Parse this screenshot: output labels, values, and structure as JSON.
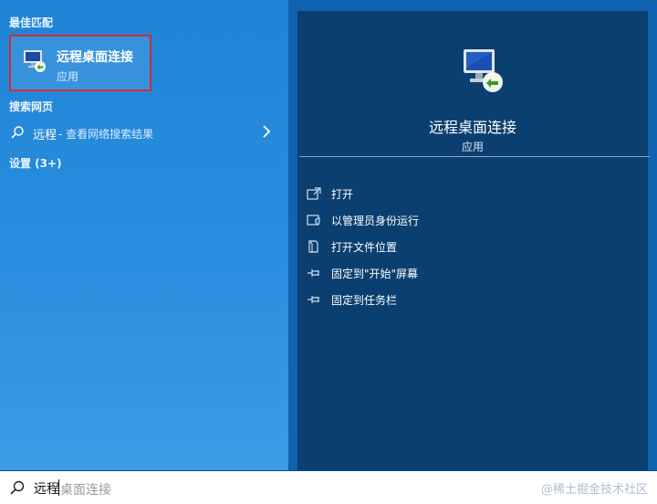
{
  "colors": {
    "left_pane": "#2a8ede",
    "right_card": "#0b3f6f",
    "highlight_border": "#d32b35"
  },
  "left": {
    "best_match_label": "最佳匹配",
    "best_match": {
      "title": "远程桌面连接",
      "subtitle": "应用",
      "icon": "remote-desktop-icon"
    },
    "web_label": "搜索网页",
    "web_item": {
      "query": "远程",
      "hint": "- 查看网络搜索结果",
      "icon": "search-icon"
    },
    "settings_label": "设置 (3+)"
  },
  "right": {
    "title": "远程桌面连接",
    "subtitle": "应用",
    "actions": [
      {
        "label": "打开",
        "icon": "open-icon"
      },
      {
        "label": "以管理员身份运行",
        "icon": "shield-icon"
      },
      {
        "label": "打开文件位置",
        "icon": "file-location-icon"
      },
      {
        "label": "固定到\"开始\"屏幕",
        "icon": "pin-icon"
      },
      {
        "label": "固定到任务栏",
        "icon": "pin-icon"
      }
    ]
  },
  "searchbar": {
    "typed": "远程",
    "suggestion": "桌面连接",
    "watermark": "@稀土掘金技术社区"
  }
}
